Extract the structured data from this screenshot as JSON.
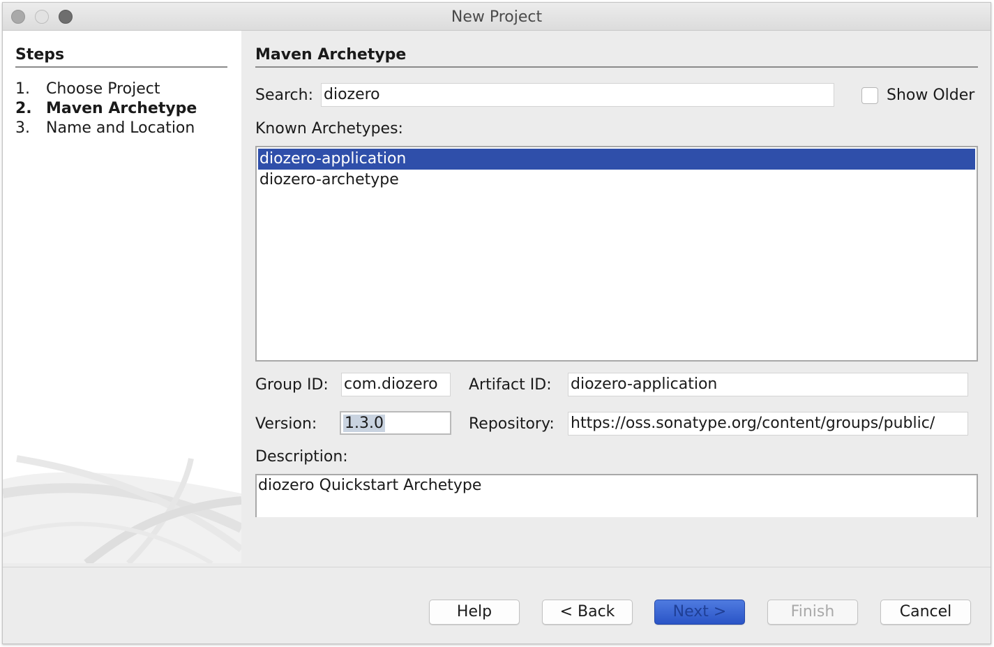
{
  "window": {
    "title": "New Project"
  },
  "steps": {
    "heading": "Steps",
    "items": [
      {
        "num": "1.",
        "label": "Choose Project",
        "current": false
      },
      {
        "num": "2.",
        "label": "Maven Archetype",
        "current": true
      },
      {
        "num": "3.",
        "label": "Name and Location",
        "current": false
      }
    ]
  },
  "panel": {
    "heading": "Maven Archetype",
    "search_label": "Search:",
    "search_value": "diozero",
    "show_older_label": "Show Older",
    "show_older_checked": false,
    "known_archetypes_label": "Known Archetypes:",
    "archetypes": [
      {
        "label": "diozero-application",
        "selected": true
      },
      {
        "label": "diozero-archetype",
        "selected": false
      }
    ],
    "group_id_label": "Group ID:",
    "group_id_value": "com.diozero",
    "artifact_id_label": "Artifact ID:",
    "artifact_id_value": "diozero-application",
    "version_label": "Version:",
    "version_value": "1.3.0",
    "repository_label": "Repository:",
    "repository_value": "https://oss.sonatype.org/content/groups/public/",
    "description_label": "Description:",
    "description_value": "diozero Quickstart Archetype"
  },
  "buttons": {
    "help": "Help",
    "back": "< Back",
    "next": "Next >",
    "finish": "Finish",
    "cancel": "Cancel"
  },
  "colors": {
    "selection": "#2f4faa",
    "primary_button": "#2a54c6"
  }
}
